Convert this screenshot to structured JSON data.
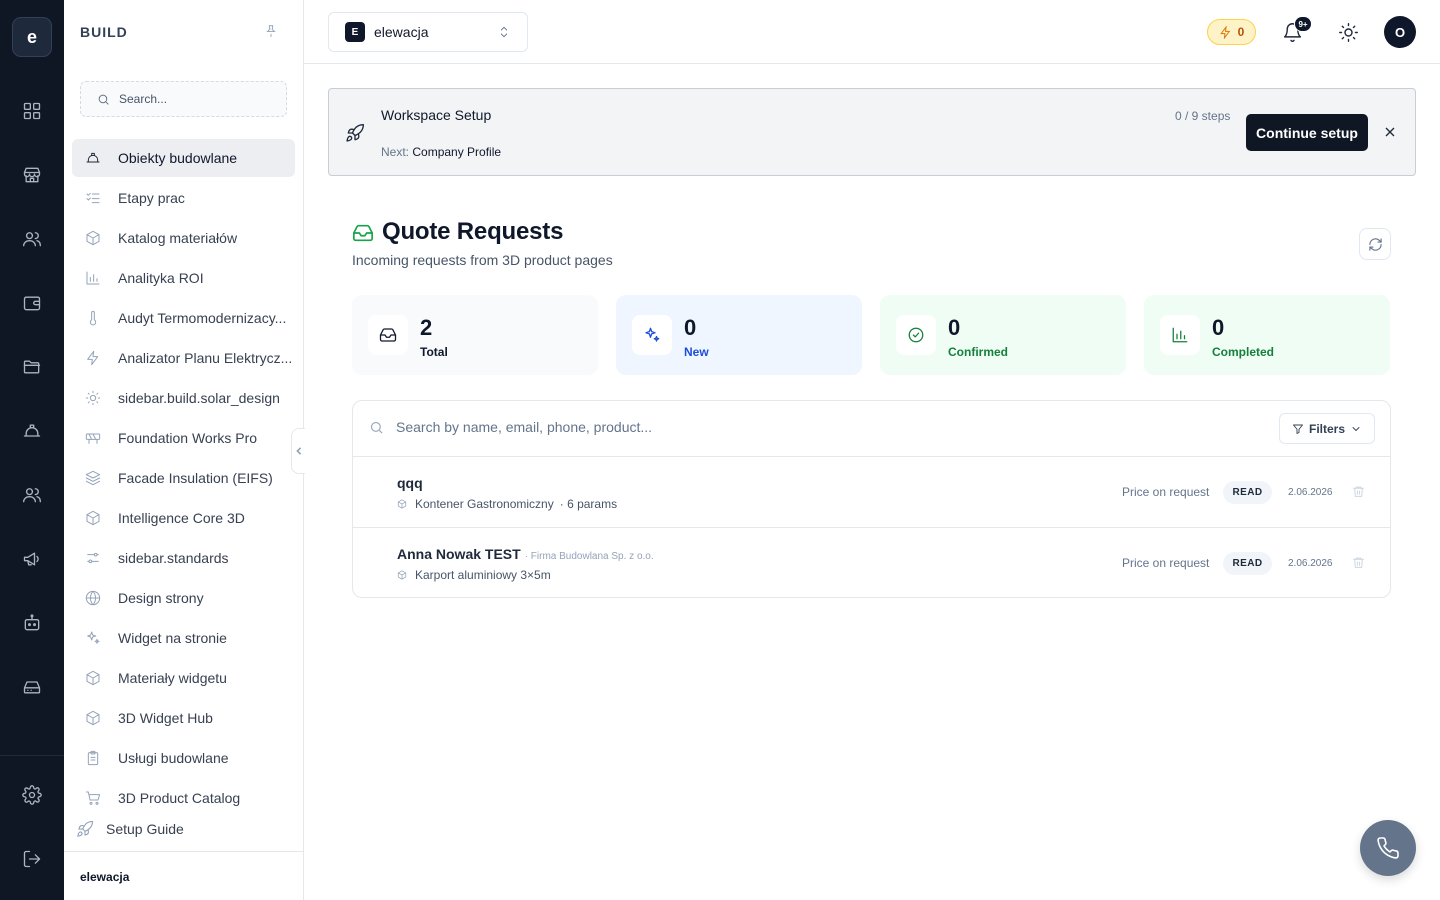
{
  "rail": {
    "logo_letter": "e",
    "icons": [
      "grid-icon",
      "store-icon",
      "users-icon",
      "wallet-icon",
      "folder-icon",
      "hard-hat-icon",
      "team-icon",
      "megaphone-icon",
      "bot-icon",
      "drive-icon",
      "settings-icon",
      "logout-icon"
    ]
  },
  "sidebar": {
    "title": "BUILD",
    "search_placeholder": "Search...",
    "items": [
      {
        "label": "Obiekty budowlane",
        "icon": "hard-hat-icon",
        "active": true
      },
      {
        "label": "Etapy prac",
        "icon": "checklist-icon"
      },
      {
        "label": "Katalog materiałów",
        "icon": "box-icon"
      },
      {
        "label": "Analityka ROI",
        "icon": "bar-chart-icon"
      },
      {
        "label": "Audyt Termomodernizacy...",
        "icon": "thermometer-icon"
      },
      {
        "label": "Analizator Planu Elektrycz...",
        "icon": "zap-icon"
      },
      {
        "label": "sidebar.build.solar_design",
        "icon": "sun-icon"
      },
      {
        "label": "Foundation Works Pro",
        "icon": "barrier-icon"
      },
      {
        "label": "Facade Insulation (EIFS)",
        "icon": "layers-icon"
      },
      {
        "label": "Intelligence Core 3D",
        "icon": "box-icon"
      },
      {
        "label": "sidebar.standards",
        "icon": "sliders-icon"
      },
      {
        "label": "Design strony",
        "icon": "globe-icon"
      },
      {
        "label": "Widget na stronie",
        "icon": "sparkles-icon"
      },
      {
        "label": "Materiały widgetu",
        "icon": "box-icon"
      },
      {
        "label": "3D Widget Hub",
        "icon": "box-icon"
      },
      {
        "label": "Usługi budowlane",
        "icon": "clipboard-icon"
      },
      {
        "label": "3D Product Catalog",
        "icon": "cart-icon"
      }
    ],
    "setup_guide": "Setup Guide",
    "footer": "elewacja"
  },
  "topbar": {
    "workspace_badge": "E",
    "workspace_name": "elewacja",
    "credits": "0",
    "notifications_badge": "9+",
    "avatar_initial": "O"
  },
  "banner": {
    "title": "Workspace Setup",
    "steps": "0 / 9 steps",
    "next_label": "Next:",
    "next_value": "Company Profile",
    "button": "Continue setup"
  },
  "page": {
    "title": "Quote Requests",
    "subtitle": "Incoming requests from 3D product pages"
  },
  "stats": [
    {
      "value": "2",
      "label": "Total",
      "bg": "#f8fafc",
      "accent": "#0f172a",
      "icon": "inbox-icon"
    },
    {
      "value": "0",
      "label": "New",
      "bg": "#eff6ff",
      "accent": "#1d4ed8",
      "icon": "sparkles-icon"
    },
    {
      "value": "0",
      "label": "Confirmed",
      "bg": "#f0fdf4",
      "accent": "#15803d",
      "icon": "check-circle-icon"
    },
    {
      "value": "0",
      "label": "Completed",
      "bg": "#f0fdf4",
      "accent": "#15803d",
      "icon": "bar-chart-icon"
    }
  ],
  "requests": {
    "search_placeholder": "Search by name, email, phone, product...",
    "filters_label": "Filters",
    "rows": [
      {
        "name": "qqq",
        "company": "",
        "product": "Kontener Gastronomiczny",
        "params": "· 6 params",
        "price": "Price on request",
        "status": "READ",
        "date": "2.06.2026"
      },
      {
        "name": "Anna Nowak TEST",
        "company": "· Firma Budowlana Sp. z o.o.",
        "product": "Karport aluminiowy 3×5m",
        "params": "",
        "price": "Price on request",
        "status": "READ",
        "date": "2.06.2026"
      }
    ]
  }
}
